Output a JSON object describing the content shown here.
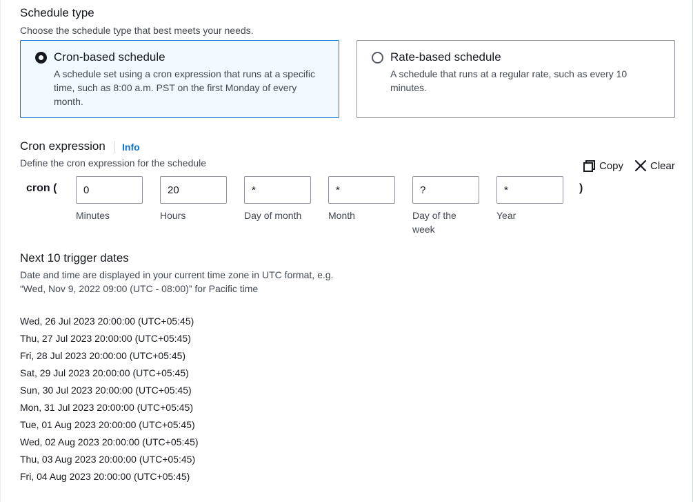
{
  "schedule_type": {
    "title": "Schedule type",
    "description": "Choose the schedule type that best meets your needs.",
    "options": [
      {
        "label": "Cron-based schedule",
        "description": "A schedule set using a cron expression that runs at a specific time, such as 8:00 a.m. PST on the first Monday of every month.",
        "selected": true
      },
      {
        "label": "Rate-based schedule",
        "description": "A schedule that runs at a regular rate, such as every 10 minutes.",
        "selected": false
      }
    ]
  },
  "cron_expression": {
    "title": "Cron expression",
    "info_link": "Info",
    "description": "Define the cron expression for the schedule",
    "copy_label": "Copy",
    "clear_label": "Clear",
    "prefix": "cron (",
    "suffix": ")",
    "fields": [
      {
        "value": "0",
        "label": "Minutes"
      },
      {
        "value": "20",
        "label": "Hours"
      },
      {
        "value": "*",
        "label": "Day of month"
      },
      {
        "value": "*",
        "label": "Month"
      },
      {
        "value": "?",
        "label": "Day of the week"
      },
      {
        "value": "*",
        "label": "Year"
      }
    ]
  },
  "trigger_dates": {
    "title": "Next 10 trigger dates",
    "description": "Date and time are displayed in your current time zone in UTC format, e.g. “Wed, Nov 9, 2022 09:00 (UTC - 08:00)” for Pacific time",
    "dates": [
      "Wed, 26 Jul 2023 20:00:00 (UTC+05:45)",
      "Thu, 27 Jul 2023 20:00:00 (UTC+05:45)",
      "Fri, 28 Jul 2023 20:00:00 (UTC+05:45)",
      "Sat, 29 Jul 2023 20:00:00 (UTC+05:45)",
      "Sun, 30 Jul 2023 20:00:00 (UTC+05:45)",
      "Mon, 31 Jul 2023 20:00:00 (UTC+05:45)",
      "Tue, 01 Aug 2023 20:00:00 (UTC+05:45)",
      "Wed, 02 Aug 2023 20:00:00 (UTC+05:45)",
      "Thu, 03 Aug 2023 20:00:00 (UTC+05:45)",
      "Fri, 04 Aug 2023 20:00:00 (UTC+05:45)"
    ]
  },
  "icons": {
    "copy": "copy-icon",
    "clear": "close-icon"
  },
  "colors": {
    "selected_border": "#0972d3",
    "selected_background": "#f1faff",
    "link": "#0972d3",
    "text": "#16191f",
    "secondary_text": "#414750"
  }
}
